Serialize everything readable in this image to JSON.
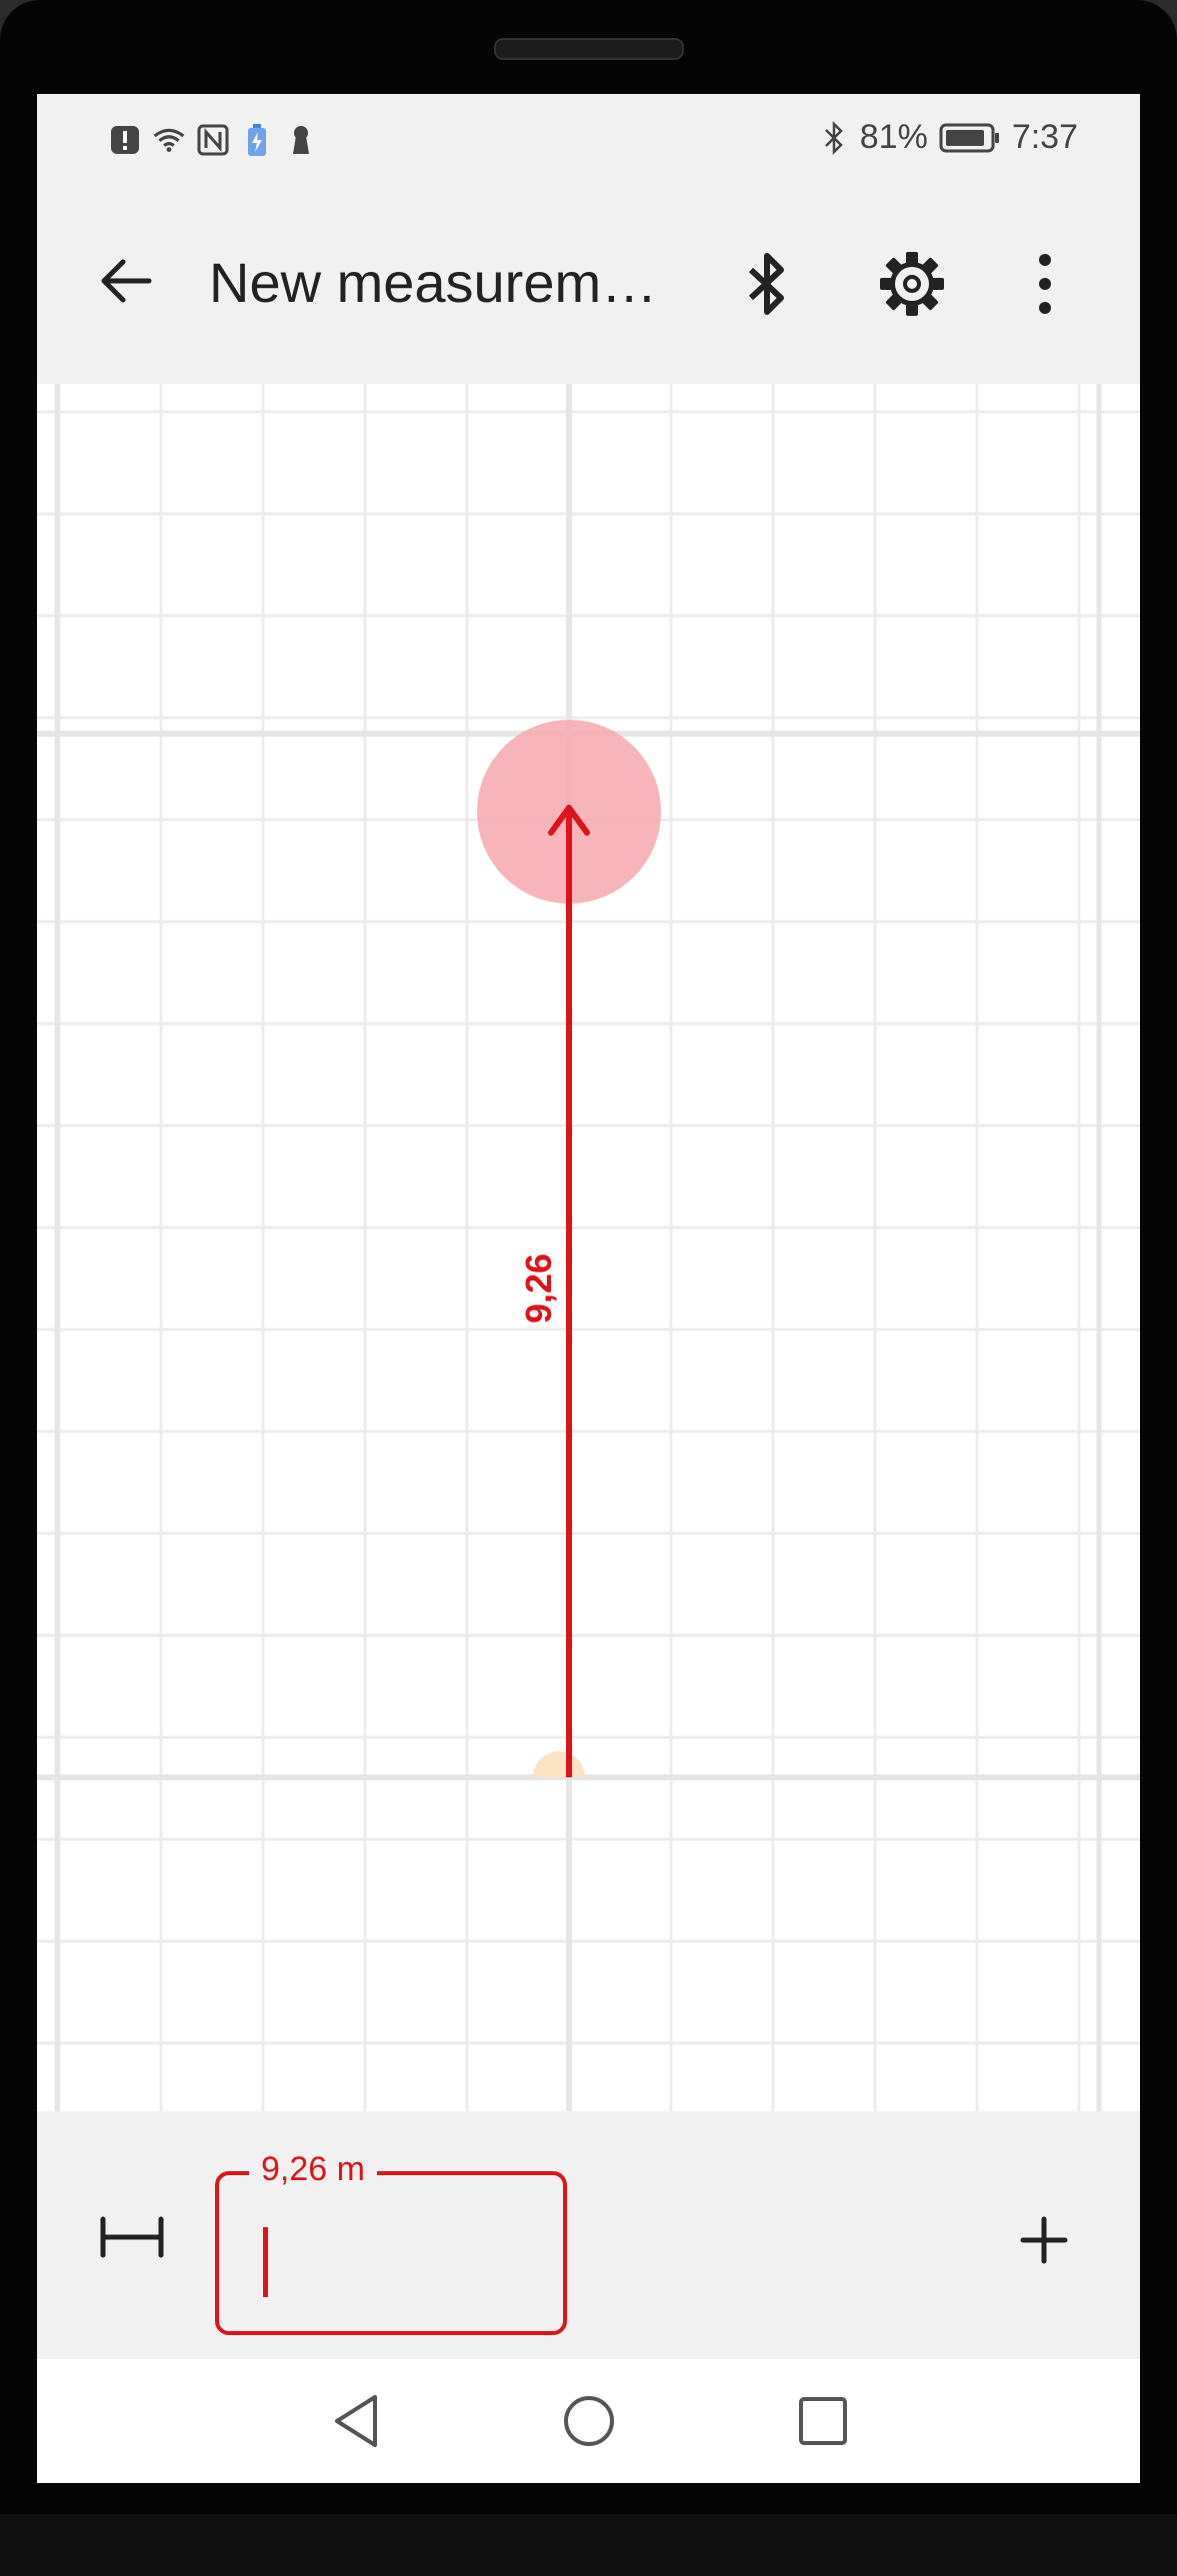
{
  "status_bar": {
    "battery_percent": "81%",
    "time": "7:37",
    "icons_left": [
      "alert-icon",
      "wifi-icon",
      "nfc-icon",
      "battery-saver-icon",
      "keyhole-icon"
    ],
    "icons_right": [
      "bluetooth-icon",
      "battery-icon"
    ]
  },
  "app_bar": {
    "title": "New measurem…",
    "actions": [
      "back-arrow-icon",
      "bluetooth-icon",
      "gear-icon",
      "more-vert-icon"
    ]
  },
  "measurement": {
    "line_label": "9,26",
    "value_with_unit": "9,26 m",
    "accent_color": "#e0121a",
    "handle_color": "#f7a8ad",
    "start_marker_color": "#fde2c4"
  },
  "bottom_panel": {
    "input_label": "9,26 m",
    "input_value": "",
    "left_tool": "dimension-icon",
    "right_tool": "add-icon"
  },
  "nav_bar": {
    "buttons": [
      "nav-back-icon",
      "nav-home-icon",
      "nav-recents-icon"
    ]
  },
  "colors": {
    "screen_bg": "#f1f1f1",
    "canvas_bg": "#ffffff",
    "grid_minor": "#ececec",
    "grid_major": "#e6e6e6"
  }
}
